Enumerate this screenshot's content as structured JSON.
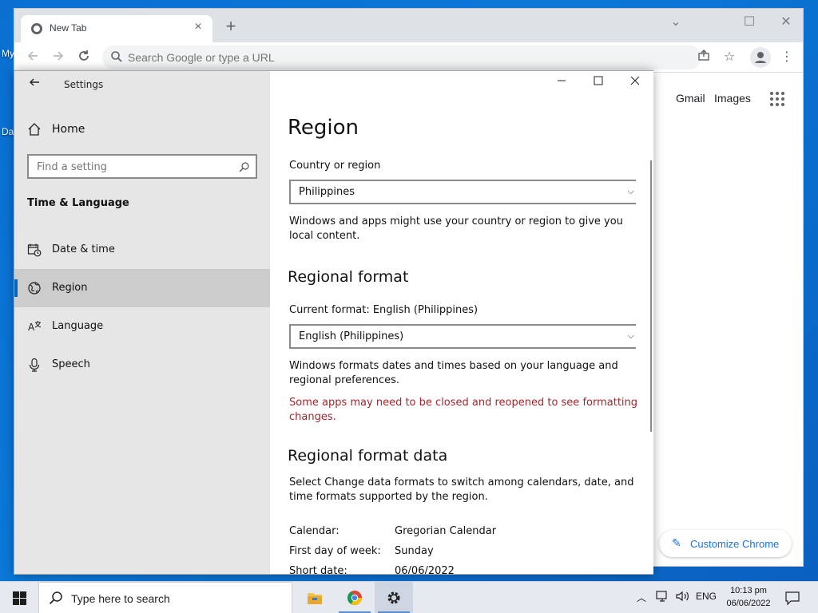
{
  "desktop": {
    "icon_label_1": "My",
    "icon_label_2": "Da"
  },
  "chrome": {
    "tab_title": "New Tab",
    "tab_close": "×",
    "new_tab": "+",
    "omnibox_placeholder": "Search Google or type a URL",
    "links": {
      "gmail": "Gmail",
      "images": "Images"
    },
    "customize_label": "Customize Chrome",
    "window_controls": [
      "⌄",
      "☐",
      "✕"
    ]
  },
  "settings": {
    "app_title": "Settings",
    "home_label": "Home",
    "search_placeholder": "Find a setting",
    "section_title": "Time & Language",
    "nav": [
      {
        "label": "Date & time",
        "icon": "calendar-clock-icon"
      },
      {
        "label": "Region",
        "icon": "globe-icon",
        "active": true
      },
      {
        "label": "Language",
        "icon": "language-icon"
      },
      {
        "label": "Speech",
        "icon": "microphone-icon"
      }
    ],
    "page_title": "Region",
    "country": {
      "label": "Country or region",
      "value": "Philippines",
      "description": "Windows and apps might use your country or region to give you local content."
    },
    "regional_format": {
      "heading": "Regional format",
      "current_label": "Current format: English (Philippines)",
      "value": "English (Philippines)",
      "description": "Windows formats dates and times based on your language and regional preferences.",
      "warning": "Some apps may need to be closed and reopened to see formatting changes."
    },
    "format_data": {
      "heading": "Regional format data",
      "description": "Select Change data formats to switch among calendars, date, and time formats supported by the region.",
      "rows": [
        {
          "key": "Calendar:",
          "value": "Gregorian Calendar"
        },
        {
          "key": "First day of week:",
          "value": "Sunday"
        },
        {
          "key": "Short date:",
          "value": "06/06/2022"
        }
      ]
    }
  },
  "taskbar": {
    "search_placeholder": "Type here to search",
    "language": "ENG",
    "time": "10:13 pm",
    "date": "06/06/2022"
  },
  "colors": {
    "accent": "#0067c0",
    "warning": "#a4262c",
    "desktop": "#0a6fd1"
  }
}
